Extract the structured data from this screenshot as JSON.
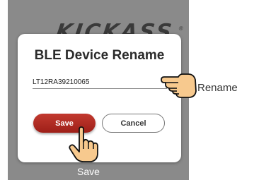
{
  "background": {
    "logo_text": "KICKASS",
    "logo_mark": "®"
  },
  "dialog": {
    "title": "BLE Device Rename",
    "input_value": "LT12RA39210065",
    "save_label": "Save",
    "cancel_label": "Cancel"
  },
  "annotations": {
    "rename_hint": "Rename",
    "save_hint": "Save"
  },
  "icons": {
    "pointer_right": "pointing-hand-right-icon",
    "pointer_up": "pointing-hand-up-icon"
  },
  "colors": {
    "backdrop": "#8a8a8a",
    "save_button": "#b02a22",
    "hand_fill": "#f7c98e"
  }
}
